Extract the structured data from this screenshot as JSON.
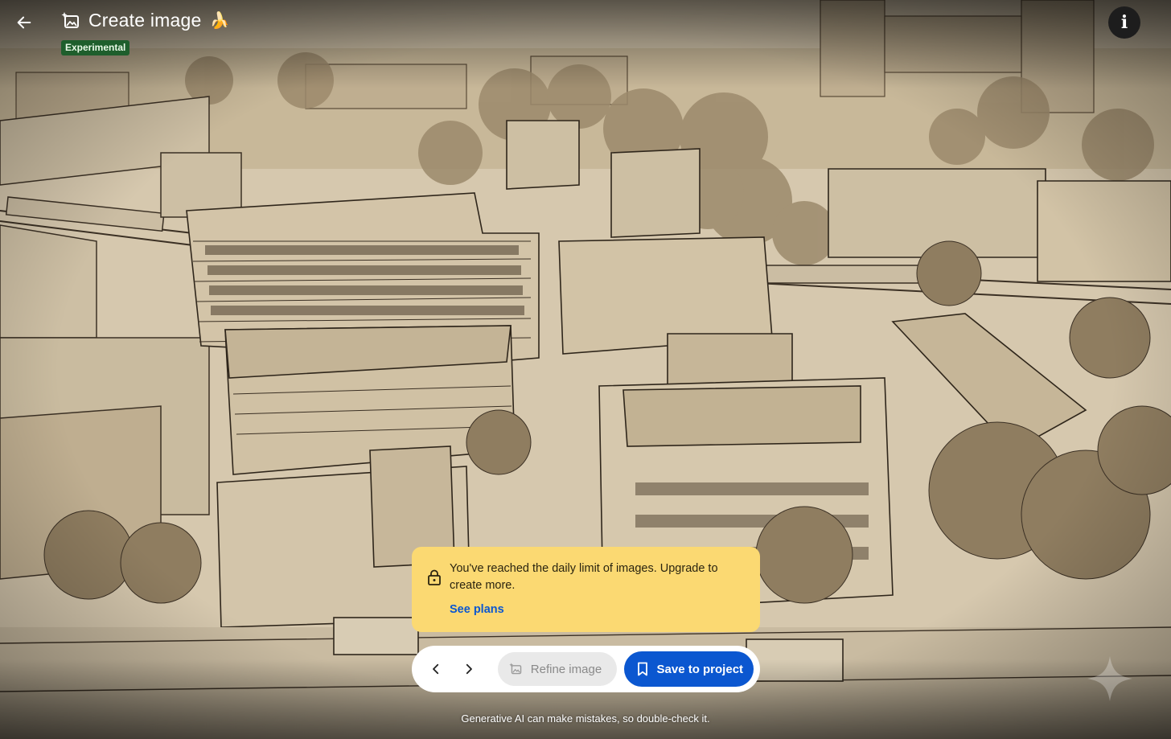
{
  "header": {
    "title": "Create image",
    "title_emoji": "🍌",
    "badge": "Experimental",
    "back_icon": "arrow-left-icon",
    "title_icon": "image-sparkle-icon",
    "info_label": "i"
  },
  "notice": {
    "message": "You've reached the daily limit of images. Upgrade to create more.",
    "link": "See plans",
    "icon": "lock-icon"
  },
  "toolbar": {
    "prev_icon": "chevron-left-icon",
    "next_icon": "chevron-right-icon",
    "refine_label": "Refine image",
    "save_label": "Save to project"
  },
  "footer": {
    "disclaimer": "Generative AI can make mistakes, so double-check it."
  },
  "colors": {
    "accent": "#0b57d0",
    "notice_bg": "#fbd972",
    "badge_bg": "#1e5e2c",
    "illustration_paper": "#d9cbb3",
    "illustration_ink": "#3b3024"
  }
}
